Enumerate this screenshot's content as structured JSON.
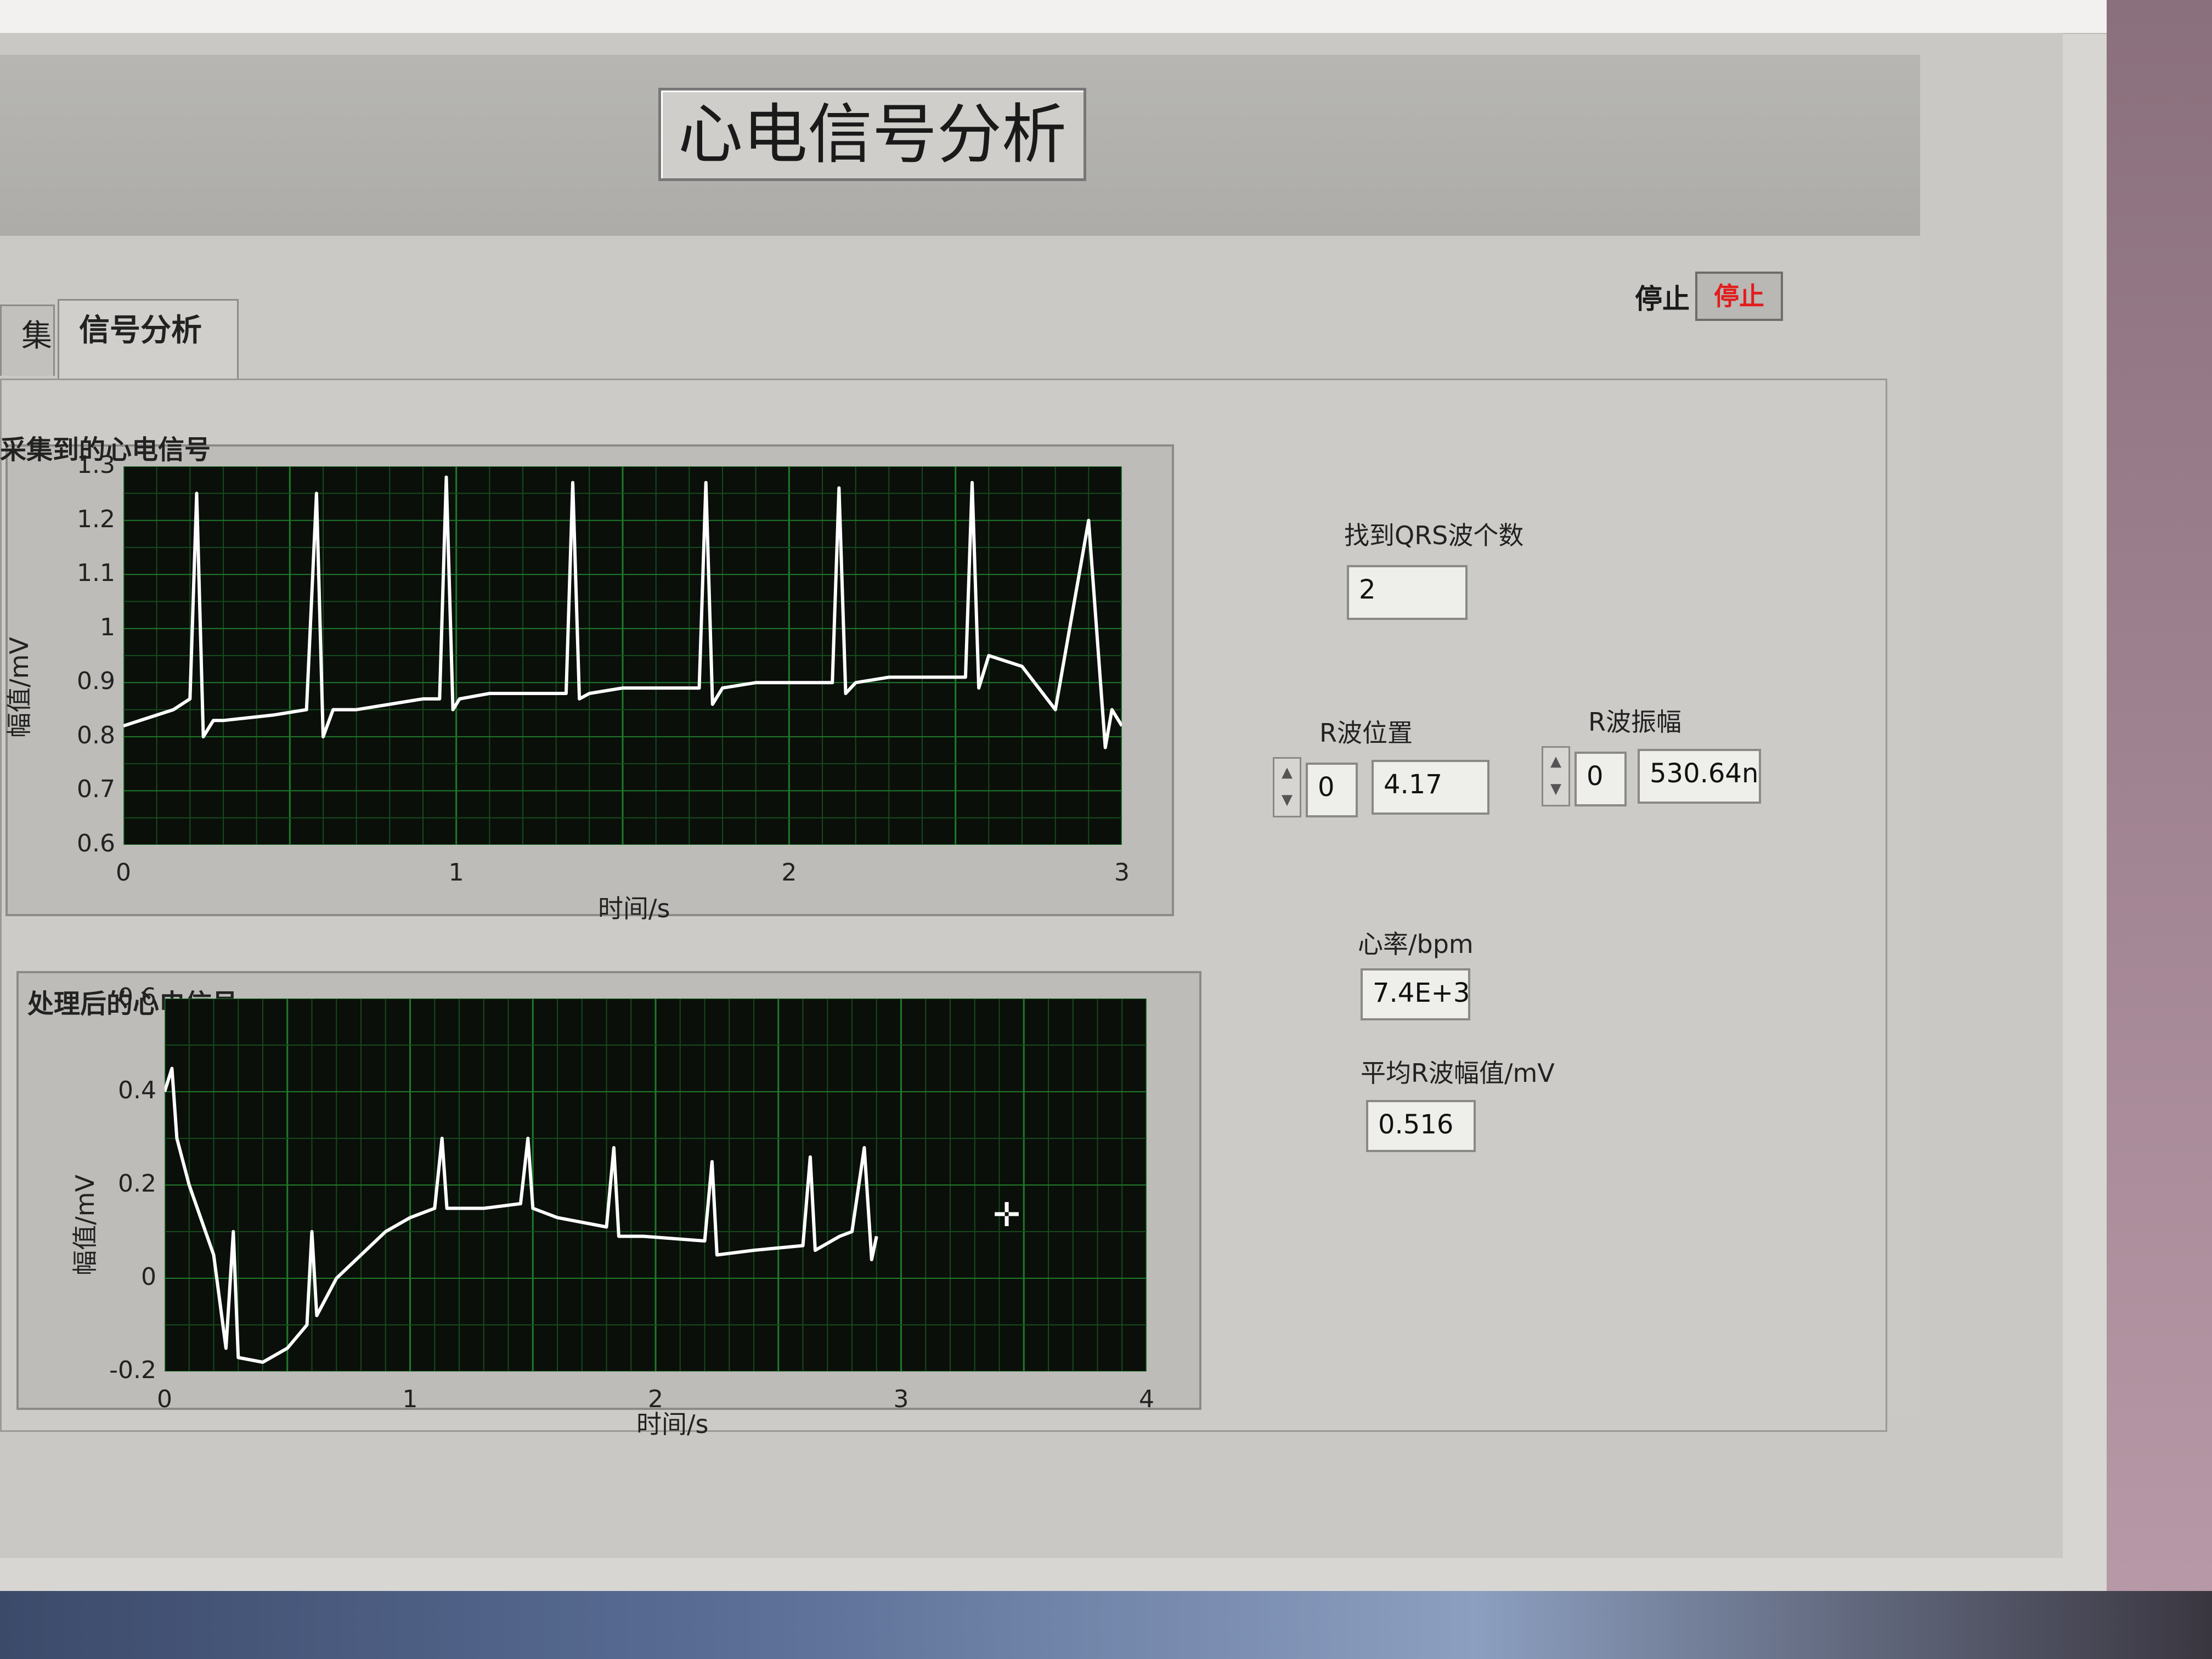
{
  "window": {
    "title": "心电信号分析"
  },
  "tabs": [
    {
      "label": "集",
      "active": false
    },
    {
      "label": "信号分析",
      "active": true
    }
  ],
  "stop": {
    "label": "停止",
    "button": "停止"
  },
  "graph_raw": {
    "label": "采集到的心电信号",
    "xlabel": "时间/s",
    "ylabel": "幅值/mV",
    "xticks": [
      "0",
      "1",
      "2",
      "3"
    ],
    "yticks": [
      "1.3",
      "1.2",
      "1.1",
      "1",
      "0.9",
      "0.8",
      "0.7",
      "0.6"
    ]
  },
  "graph_proc": {
    "label": "处理后的心电信号",
    "xlabel": "时间/s",
    "ylabel": "幅值/mV",
    "xticks": [
      "0",
      "1",
      "2",
      "3",
      "4"
    ],
    "yticks": [
      "0.6",
      "0.4",
      "0.2",
      "0",
      "-0.2"
    ]
  },
  "indicators": {
    "qrs_count_label": "找到QRS波个数",
    "qrs_count_value": "2",
    "r_pos_label": "R波位置",
    "r_pos_index": "0",
    "r_pos_value": "4.17",
    "r_amp_label": "R波振幅",
    "r_amp_index": "0",
    "r_amp_value": "530.64n",
    "hr_label": "心率/bpm",
    "hr_value": "7.4E+3",
    "avg_amp_label": "平均R波幅值/mV",
    "avg_amp_value": "0.516"
  },
  "chart_data": [
    {
      "type": "line",
      "title": "采集到的心电信号",
      "xlabel": "时间/s",
      "ylabel": "幅值/mV",
      "xlim": [
        0,
        3
      ],
      "ylim": [
        0.6,
        1.3
      ],
      "grid": true,
      "series": [
        {
          "x": [
            0,
            0.15,
            0.2,
            0.22,
            0.24,
            0.27,
            0.3,
            0.45,
            0.55,
            0.58,
            0.6,
            0.63,
            0.7,
            0.9,
            0.95,
            0.97,
            0.99,
            1.01,
            1.1,
            1.3,
            1.33,
            1.35,
            1.37,
            1.4,
            1.5,
            1.7,
            1.73,
            1.75,
            1.77,
            1.8,
            1.9,
            2.1,
            2.13,
            2.15,
            2.17,
            2.2,
            2.3,
            2.5,
            2.53,
            2.55,
            2.57,
            2.6,
            2.7,
            2.8,
            2.9,
            2.95,
            2.97,
            3.0
          ],
          "y": [
            0.82,
            0.85,
            0.87,
            1.25,
            0.8,
            0.83,
            0.83,
            0.84,
            0.85,
            1.25,
            0.8,
            0.85,
            0.85,
            0.87,
            0.87,
            1.28,
            0.85,
            0.87,
            0.88,
            0.88,
            0.88,
            1.27,
            0.87,
            0.88,
            0.89,
            0.89,
            0.89,
            1.27,
            0.86,
            0.89,
            0.9,
            0.9,
            0.9,
            1.26,
            0.88,
            0.9,
            0.91,
            0.91,
            0.91,
            1.27,
            0.89,
            0.95,
            0.93,
            0.85,
            1.2,
            0.78,
            0.85,
            0.82
          ]
        }
      ]
    },
    {
      "type": "line",
      "title": "处理后的心电信号",
      "xlabel": "时间/s",
      "ylabel": "幅值/mV",
      "xlim": [
        0,
        4
      ],
      "ylim": [
        -0.2,
        0.6
      ],
      "grid": true,
      "series": [
        {
          "x": [
            0,
            0.03,
            0.05,
            0.1,
            0.2,
            0.25,
            0.28,
            0.3,
            0.4,
            0.5,
            0.58,
            0.6,
            0.62,
            0.7,
            0.9,
            1.0,
            1.1,
            1.13,
            1.15,
            1.3,
            1.45,
            1.48,
            1.5,
            1.6,
            1.8,
            1.83,
            1.85,
            1.95,
            2.2,
            2.23,
            2.25,
            2.4,
            2.6,
            2.63,
            2.65,
            2.75,
            2.8,
            2.85,
            2.88,
            2.9
          ],
          "y": [
            0.4,
            0.45,
            0.3,
            0.2,
            0.05,
            -0.15,
            0.1,
            -0.17,
            -0.18,
            -0.15,
            -0.1,
            0.1,
            -0.08,
            0.0,
            0.1,
            0.13,
            0.15,
            0.3,
            0.15,
            0.15,
            0.16,
            0.3,
            0.15,
            0.13,
            0.11,
            0.28,
            0.09,
            0.09,
            0.08,
            0.25,
            0.05,
            0.06,
            0.07,
            0.26,
            0.06,
            0.09,
            0.1,
            0.28,
            0.04,
            0.09
          ]
        }
      ]
    }
  ]
}
